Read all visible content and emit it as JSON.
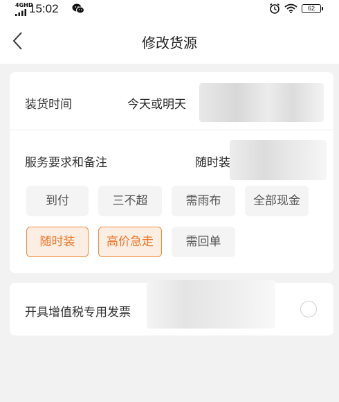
{
  "status_bar": {
    "network": "4GHD",
    "time": "15:02",
    "battery": "62",
    "icons": [
      "signal-icon",
      "wechat-icon",
      "alarm-icon",
      "wifi-icon",
      "battery-icon"
    ]
  },
  "header": {
    "title": "修改货源",
    "back_icon": "chevron-left-icon"
  },
  "loading_time": {
    "label": "装货时间",
    "value": "今天或明天"
  },
  "service": {
    "label": "服务要求和备注",
    "value": "随时装",
    "tags": [
      {
        "label": "到付",
        "selected": false
      },
      {
        "label": "三不超",
        "selected": false
      },
      {
        "label": "需雨布",
        "selected": false
      },
      {
        "label": "全部现金",
        "selected": false
      },
      {
        "label": "随时装",
        "selected": true
      },
      {
        "label": "高价急走",
        "selected": true
      },
      {
        "label": "需回单",
        "selected": false
      }
    ]
  },
  "invoice": {
    "label": "开具增值税专用发票",
    "checked": false
  },
  "colors": {
    "accent": "#ef8a3c",
    "accent_text": "#e9782a",
    "selected_bg": "#fdeee4",
    "tag_bg": "#f4f4f4",
    "page_bg": "#f2f2f2"
  }
}
